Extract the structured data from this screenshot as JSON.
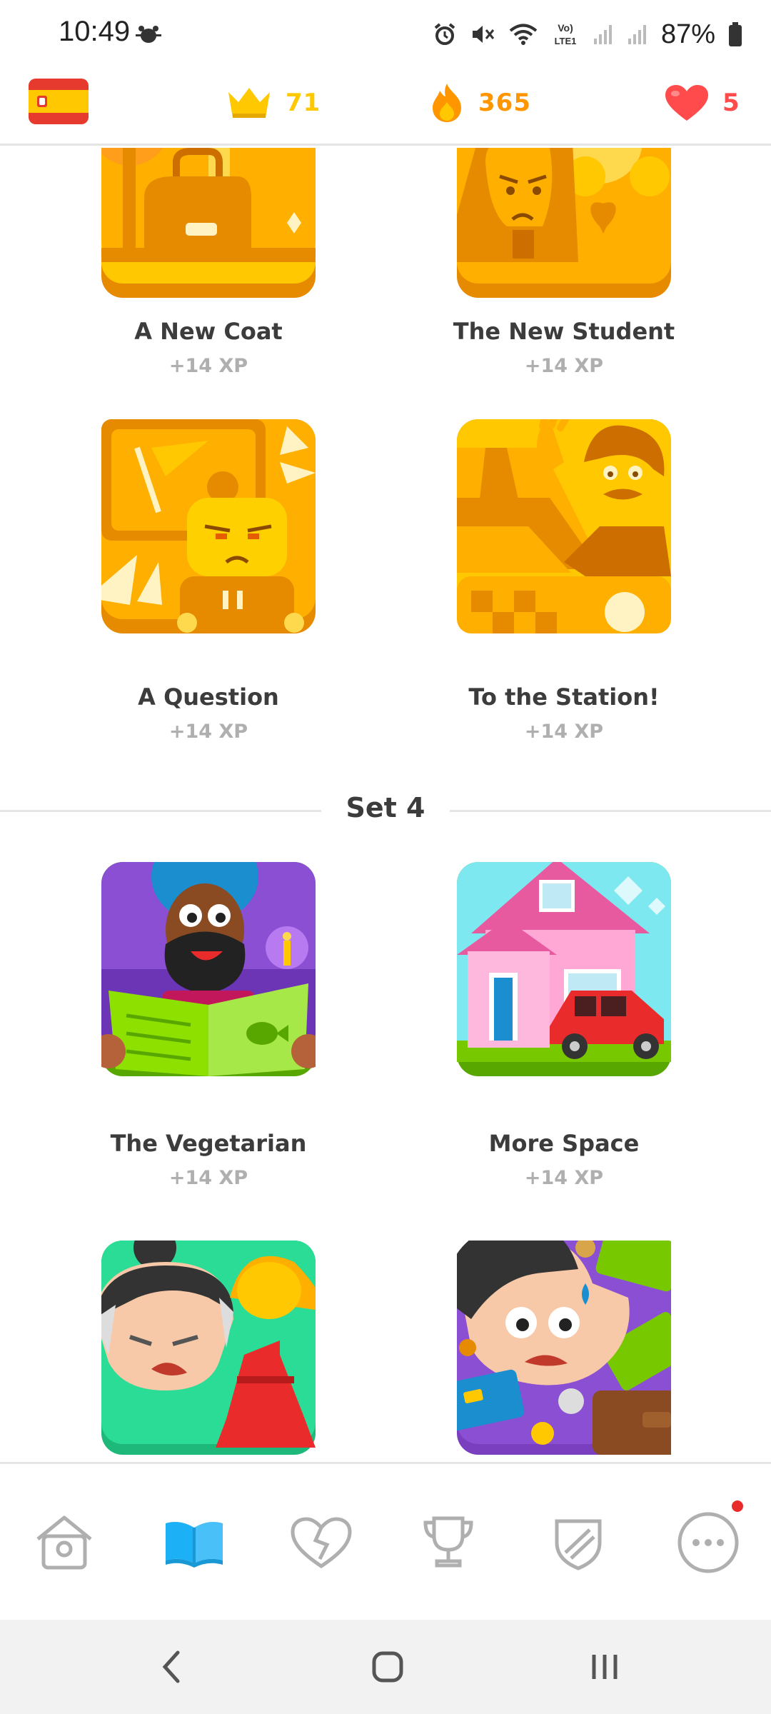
{
  "status_bar": {
    "time": "10:49",
    "battery": "87%",
    "icons": [
      "alarm-icon",
      "mute-icon",
      "wifi-icon",
      "volte-icon",
      "signal-icon",
      "signal-icon",
      "battery-icon"
    ]
  },
  "top_bar": {
    "language_flag": "spain-flag",
    "crowns": "71",
    "streak": "365",
    "hearts": "5",
    "colors": {
      "crown": "#ffc800",
      "streak": "#ff9600",
      "hearts": "#ff4b4b"
    }
  },
  "stories": [
    {
      "title": "A New Coat",
      "xp": "+14 XP"
    },
    {
      "title": "The New Student",
      "xp": "+14 XP"
    },
    {
      "title": "A Question",
      "xp": "+14 XP"
    },
    {
      "title": "To the Station!",
      "xp": "+14 XP"
    },
    {
      "title": "The Vegetarian",
      "xp": "+14 XP"
    },
    {
      "title": "More Space",
      "xp": "+14 XP"
    }
  ],
  "set_label": "Set 4",
  "bottom_nav": {
    "items": [
      "home-icon",
      "stories-book-icon",
      "broken-heart-icon",
      "trophy-icon",
      "shield-icon",
      "more-icon"
    ],
    "active": "stories-book-icon",
    "active_color": "#1cb0f6"
  },
  "system_nav": [
    "back-icon",
    "home-button-icon",
    "recents-icon"
  ]
}
